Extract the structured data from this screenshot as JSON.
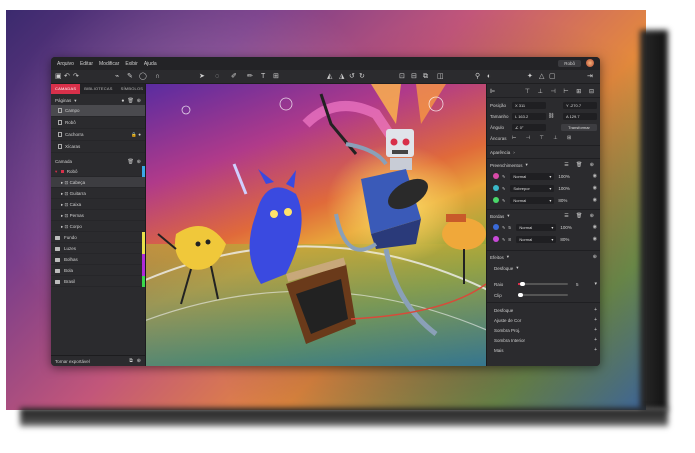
{
  "menu": {
    "items": [
      "Arquivo",
      "Editar",
      "Modificar",
      "Exibir",
      "Ajuda"
    ],
    "user": "Robô"
  },
  "left": {
    "tabs": [
      "CAMADAS",
      "BIBLIOTECAS",
      "SÍMBOLOS"
    ],
    "pages_title": "Páginas",
    "pages": [
      "Campo",
      "Robô",
      "Cachorra",
      "Xícaras"
    ],
    "layer_title": "Camada",
    "root_layer": "Robô",
    "children": [
      "Cabeça",
      "Guitarra",
      "Caixa",
      "Pernas",
      "Corpo"
    ],
    "groups": [
      {
        "label": "Fundo",
        "color": "#e8e04a"
      },
      {
        "label": "Luzes",
        "color": "#e8e04a"
      },
      {
        "label": "Bolhas",
        "color": "#b02ad8"
      },
      {
        "label": "Bola",
        "color": "#b02ad8"
      },
      {
        "label": "Brasil",
        "color": "#3ad84a"
      }
    ],
    "footer": "Tornar exportável"
  },
  "right": {
    "position_label": "Posição",
    "pos_x": "311",
    "pos_y": "-270.7",
    "size_label": "Tamanho",
    "size_w": "163.2",
    "size_h": "129.7",
    "angle_label": "Ângulo",
    "angle": "0°",
    "transform_button": "Transformar",
    "anchors_label": "Âncoras",
    "appearance_label": "Aparência",
    "fills_label": "Preenchimentos",
    "fills": [
      {
        "mode": "Normal",
        "opacity": "100%",
        "color": "#d84aa8"
      },
      {
        "mode": "Sobrepor",
        "opacity": "100%",
        "color": "#3ab8c8"
      },
      {
        "mode": "Normal",
        "opacity": "80%",
        "color": "#4ad86a"
      }
    ],
    "borders_label": "Bordas",
    "borders": [
      {
        "size": "5",
        "mode": "Normal",
        "opacity": "100%",
        "color": "#3a6ad8"
      },
      {
        "size": "8",
        "mode": "Normal",
        "opacity": "80%",
        "color": "#c84ad8"
      }
    ],
    "effects_label": "Efeitos",
    "effect_blur": "Desfoque",
    "raio_label": "Raio",
    "raio_value": "5",
    "raio_fraction": 0.08,
    "clip_label": "Clip",
    "effects_list": [
      "Desfoque",
      "Ajuste de Cor",
      "Sombra Proj.",
      "Sombra Interior",
      "Mais"
    ]
  }
}
